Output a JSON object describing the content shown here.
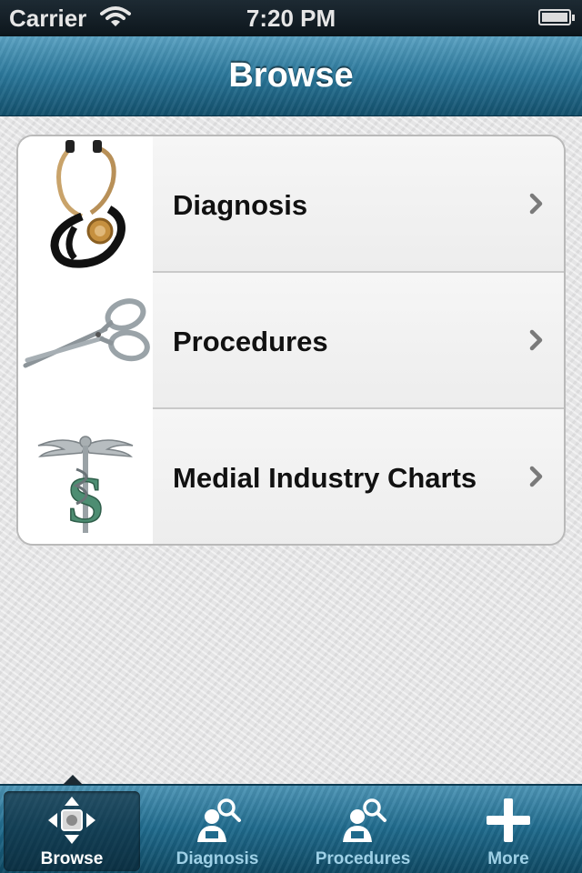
{
  "status_bar": {
    "carrier": "Carrier",
    "time": "7:20 PM"
  },
  "nav": {
    "title": "Browse"
  },
  "rows": [
    {
      "label": "Diagnosis",
      "icon": "stethoscope-icon"
    },
    {
      "label": "Procedures",
      "icon": "scissors-icon"
    },
    {
      "label": "Medial Industry Charts",
      "icon": "caduceus-dollar-icon"
    }
  ],
  "tabs": [
    {
      "label": "Browse",
      "icon": "browse-arrows-icon",
      "selected": true
    },
    {
      "label": "Diagnosis",
      "icon": "person-search-icon",
      "selected": false
    },
    {
      "label": "Procedures",
      "icon": "person-search-icon",
      "selected": false
    },
    {
      "label": "More",
      "icon": "plus-icon",
      "selected": false
    }
  ],
  "colors": {
    "nav_bar": "#2a7699",
    "tab_bar": "#1f6a8c",
    "tab_label": "#9ed0e6",
    "chevron": "#7a7a7a"
  }
}
